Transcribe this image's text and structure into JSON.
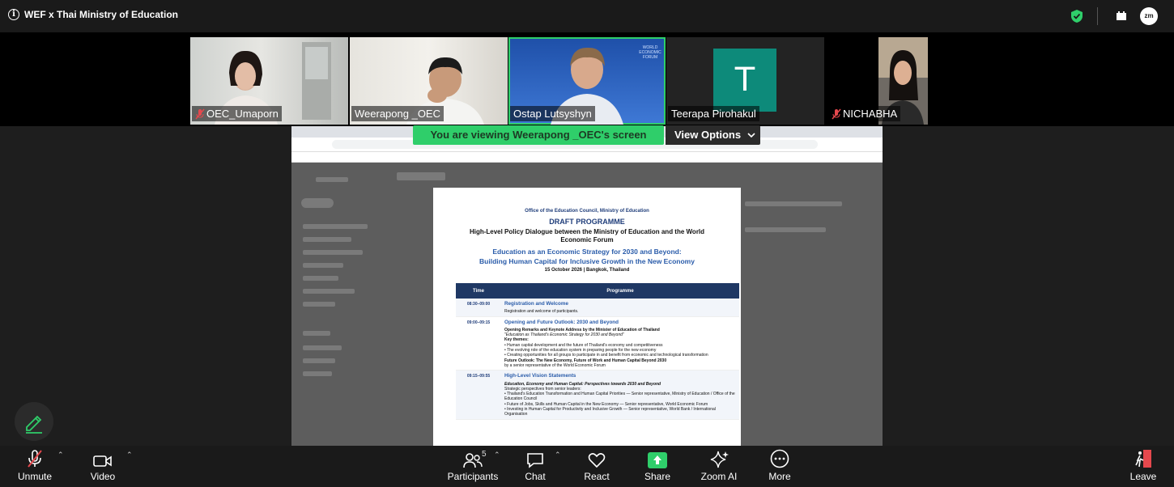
{
  "meeting": {
    "title": "WEF x Thai Ministry of Education"
  },
  "participants_strip": [
    {
      "name": "OEC_Umaporn",
      "muted": true
    },
    {
      "name": "Weerapong _OEC",
      "muted": false
    },
    {
      "name": "Ostap Lutsyshyn",
      "muted": false
    },
    {
      "name": "Teerapa Pirohakul",
      "muted": false,
      "avatar_letter": "T"
    },
    {
      "name": "NICHABHA",
      "muted": true
    }
  ],
  "share_banner": {
    "text": "You are viewing  Weerapong _OEC's screen",
    "view_options": "View Options"
  },
  "document": {
    "org": "Office of the Education Council, Ministry of Education",
    "heading": "DRAFT PROGRAMME",
    "dialogue": "High-Level Policy Dialogue between the Ministry of Education and the World Economic Forum",
    "theme_line1": "Education as an Economic Strategy for 2030 and Beyond:",
    "theme_line2": "Building Human Capital for Inclusive Growth in the New Economy",
    "date": "15 October 2026 | Bangkok, Thailand",
    "col_time": "Time",
    "col_programme": "Programme",
    "rows": [
      {
        "time": "08:30–09:00",
        "session": "Registration and Welcome",
        "lines": [
          "Registration and welcome of participants."
        ]
      },
      {
        "time": "09:00–09:15",
        "session": "Opening and Future Outlook: 2030 and Beyond",
        "lines": [
          "Opening Remarks and Keynote Address by the Minister of Education of Thailand",
          "\"Education as Thailand's Economic Strategy for 2030 and Beyond\"",
          "Key themes:",
          "• Human capital development and the future of Thailand's economy and competitiveness",
          "• The evolving role of the education system in preparing people for the new economy",
          "• Creating opportunities for all groups to participate in and benefit from economic and technological transformation",
          "Future Outlook: The New Economy, Future of Work and Human Capital Beyond 2030",
          "by a senior representative of the World Economic Forum"
        ]
      },
      {
        "time": "09:15–09:55",
        "session": "High-Level Vision Statements",
        "lines": [
          "Education, Economy and Human Capital: Perspectives towards 2030 and Beyond",
          "Strategic perspectives from senior leaders:",
          "• Thailand's Education Transformation and Human Capital Priorities — Senior representative, Ministry of Education / Office of the Education Council",
          "• Future of Jobs, Skills and Human Capital in the New Economy — Senior representative, World Economic Forum",
          "• Investing in Human Capital for Productivity and Inclusive Growth — Senior representative, World Bank / International Organisation"
        ]
      }
    ]
  },
  "toolbar": {
    "unmute": "Unmute",
    "video": "Video",
    "participants": "Participants",
    "participants_count": "5",
    "chat": "Chat",
    "react": "React",
    "share": "Share",
    "zoom_ai": "Zoom AI",
    "more": "More",
    "leave": "Leave"
  },
  "colors": {
    "accent_green": "#2fce6a",
    "leave_red": "#e5484d",
    "doc_header_navy": "#1f3864"
  }
}
